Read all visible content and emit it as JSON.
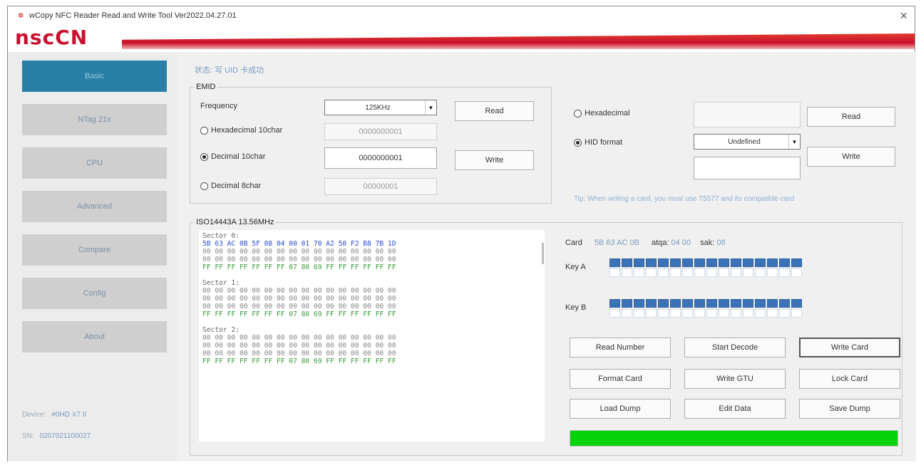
{
  "window": {
    "title": "wCopy NFC Reader Read and Write Tool  Ver2022.04.27.01",
    "logo": "nscCN"
  },
  "sidebar": {
    "items": [
      {
        "label": "Basic"
      },
      {
        "label": "NTag 21x"
      },
      {
        "label": "CPU"
      },
      {
        "label": "Advanced"
      },
      {
        "label": "Compare"
      },
      {
        "label": "Config"
      },
      {
        "label": "About"
      }
    ],
    "device_label": "Device:",
    "device_value": "#0HD X7 II",
    "sn_label": "SN:",
    "sn_value": "0207021100027"
  },
  "status": "状态: 写 UID 卡成功",
  "emid": {
    "legend": "EMID",
    "frequency_label": "Frequency",
    "frequency_value": "125KHz",
    "radio_hex": "Hexadecimal 10char",
    "radio_dec10": "Decimal 10char",
    "radio_dec8": "Decimal 8char",
    "hex_value": "0000000001",
    "dec10_value": "0000000001",
    "dec8_value": "00000001",
    "read_label": "Read",
    "write_label": "Write"
  },
  "hid": {
    "radio_hex": "Hexadecimal",
    "radio_hid": "HID format",
    "format_value": "Undefined",
    "read_label": "Read",
    "write_label": "Write",
    "tip": "Tip: When writing a card, you must use T5577 and its compatible card"
  },
  "iso": {
    "legend": "ISO14443A 13.56MHz",
    "card_label": "Card",
    "card_uid": "5B 63 AC 0B",
    "atqa_label": "atqa:",
    "atqa_value": "04 00",
    "sak_label": "sak:",
    "sak_value": "08",
    "key_a_label": "Key A",
    "key_b_label": "Key B",
    "key_a_found": 16,
    "key_b_found": 16,
    "progress": 1.0,
    "progress_color": "#06d40a",
    "hex_lines": [
      {
        "t": "hdr",
        "s": "Sector 0:"
      },
      {
        "t": "uid",
        "s": "5B 63 AC 0B 5F 08 04 00 01 70 A2 50 F2 B8 7B 1D"
      },
      {
        "t": "data",
        "s": "00 00 00 00 00 00 00 00 00 00 00 00 00 00 00 00"
      },
      {
        "t": "data",
        "s": "00 00 00 00 00 00 00 00 00 00 00 00 00 00 00 00"
      },
      {
        "t": "trailer",
        "s": "FF FF FF FF FF FF FF 07 80 69 FF FF FF FF FF FF"
      },
      {
        "t": "hdr",
        "s": ""
      },
      {
        "t": "hdr",
        "s": "Sector 1:"
      },
      {
        "t": "data",
        "s": "00 00 00 00 00 00 00 00 00 00 00 00 00 00 00 00"
      },
      {
        "t": "data",
        "s": "00 00 00 00 00 00 00 00 00 00 00 00 00 00 00 00"
      },
      {
        "t": "data",
        "s": "00 00 00 00 00 00 00 00 00 00 00 00 00 00 00 00"
      },
      {
        "t": "trailer",
        "s": "FF FF FF FF FF FF FF 07 80 69 FF FF FF FF FF FF"
      },
      {
        "t": "hdr",
        "s": ""
      },
      {
        "t": "hdr",
        "s": "Sector 2:"
      },
      {
        "t": "data",
        "s": "00 00 00 00 00 00 00 00 00 00 00 00 00 00 00 00"
      },
      {
        "t": "data",
        "s": "00 00 00 00 00 00 00 00 00 00 00 00 00 00 00 00"
      },
      {
        "t": "data",
        "s": "00 00 00 00 00 00 00 00 00 00 00 00 00 00 00 00"
      },
      {
        "t": "trailer",
        "s": "FF FF FF FF FF FF FF 07 80 69 FF FF FF FF FF FF"
      }
    ],
    "buttons": {
      "read_number": "Read Number",
      "start_decode": "Start Decode",
      "write_card": "Write Card",
      "format_card": "Format Card",
      "write_gtu": "Write GTU",
      "lock_card": "Lock Card",
      "load_dump": "Load Dump",
      "edit_data": "Edit Data",
      "save_dump": "Save Dump"
    }
  }
}
